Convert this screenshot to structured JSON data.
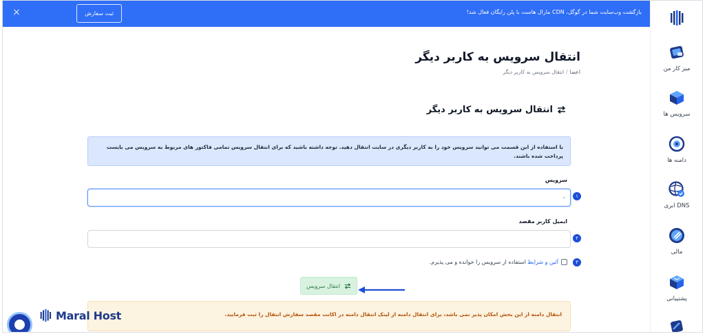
{
  "banner": {
    "message": "بازگشت وب‌سایت شما در گوگل، CDN مارال هاست با پلن رایگان فعال شد!",
    "order_button": "ثبت سفارش",
    "close_label": "×"
  },
  "sidebar": {
    "items": [
      {
        "label": "میز کار من",
        "icon": "dashboard-icon"
      },
      {
        "label": "سرویس ها",
        "icon": "services-box-icon"
      },
      {
        "label": "دامنه ها",
        "icon": "domains-globe-icon"
      },
      {
        "label": "DNS ابری",
        "icon": "cloud-dns-icon"
      },
      {
        "label": "مالی",
        "icon": "finance-icon"
      },
      {
        "label": "پشتیبانی",
        "icon": "support-icon"
      }
    ]
  },
  "page": {
    "title": "انتقال سرویس به کاربر دیگر",
    "breadcrumb": {
      "root": "اعضا",
      "current": "انتقال سرویس به کاربر دیگر"
    },
    "section_title": "انتقال سرویس به کاربر دیگر",
    "info": "با استفاده از این قسمت می توانید سرویس خود را به کاربر دیگری در سایت انتقال دهید. توجه داشته باشید که برای انتقال سرویس تمامی فاکتور های مربوط به سرویس می بایست پرداخت شده باشند.",
    "service_label": "سرویس",
    "service_value": "",
    "email_label": "ایمیل کاربر مقصد",
    "email_value": "",
    "terms_link": "آئین و شرایط",
    "terms_text": "استفاده از سرویس را خوانده و می پذیرم.",
    "submit_label": "انتقال سرویس",
    "warning": "انتقال دامنه از این بخش امکان پذیر نمی باشد، برای انتقال دامنه از لینک انتقال دامنه در اکانت مقصد سفارش انتقال را ثبت فرمایید.",
    "steps": [
      "۱",
      "۲",
      "۳"
    ]
  },
  "brand": {
    "name": "Maral Host"
  },
  "colors": {
    "primary": "#2f6ef6",
    "info_bg": "#dbe7fd",
    "warn_bg": "#fdf3e1",
    "success_bg": "#d9f2e0"
  }
}
